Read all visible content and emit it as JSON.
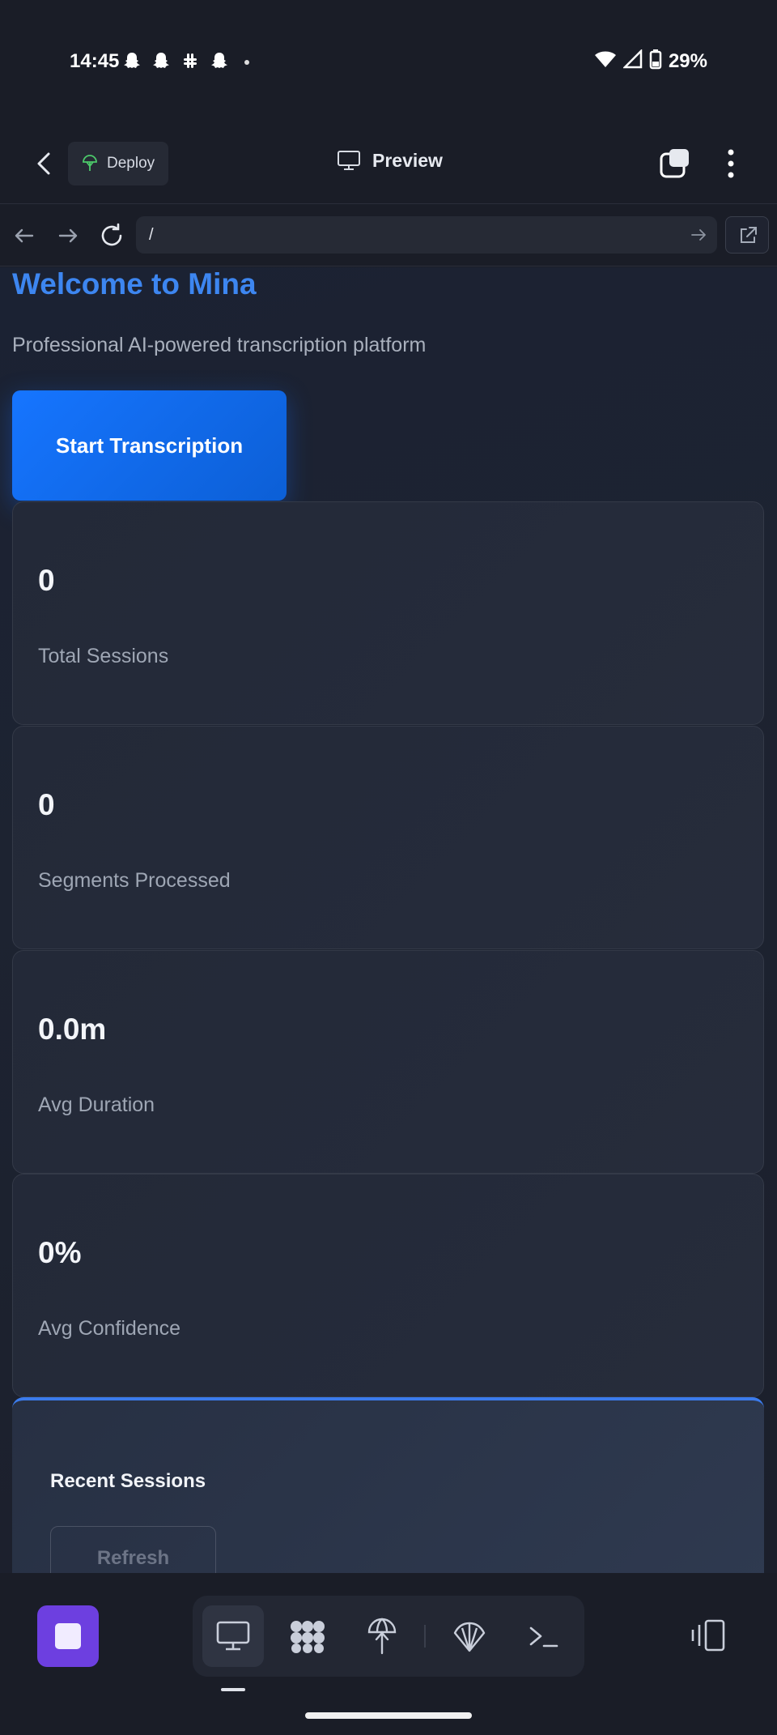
{
  "status_bar": {
    "time": "14:45",
    "battery": "29%"
  },
  "header": {
    "deploy_label": "Deploy",
    "preview_label": "Preview"
  },
  "browser": {
    "url": "/"
  },
  "page": {
    "welcome_title": "Welcome to Mina",
    "subtitle": "Professional AI-powered transcription platform",
    "start_button": "Start Transcription",
    "stats": [
      {
        "value": "0",
        "label": "Total Sessions"
      },
      {
        "value": "0",
        "label": "Segments Processed"
      },
      {
        "value": "0.0m",
        "label": "Avg Duration"
      },
      {
        "value": "0%",
        "label": "Avg Confidence"
      }
    ],
    "recent": {
      "title": "Recent Sessions",
      "refresh_button": "Refresh"
    }
  },
  "dock": {
    "tools": [
      "monitor-icon",
      "agents-icon",
      "deploy-icon",
      "shell-icon",
      "terminal-icon"
    ]
  },
  "colors": {
    "accent_blue": "#1675ff",
    "title_blue": "#3d86f0",
    "stop_purple": "#6d3fe0",
    "background": "#1a1d27"
  }
}
